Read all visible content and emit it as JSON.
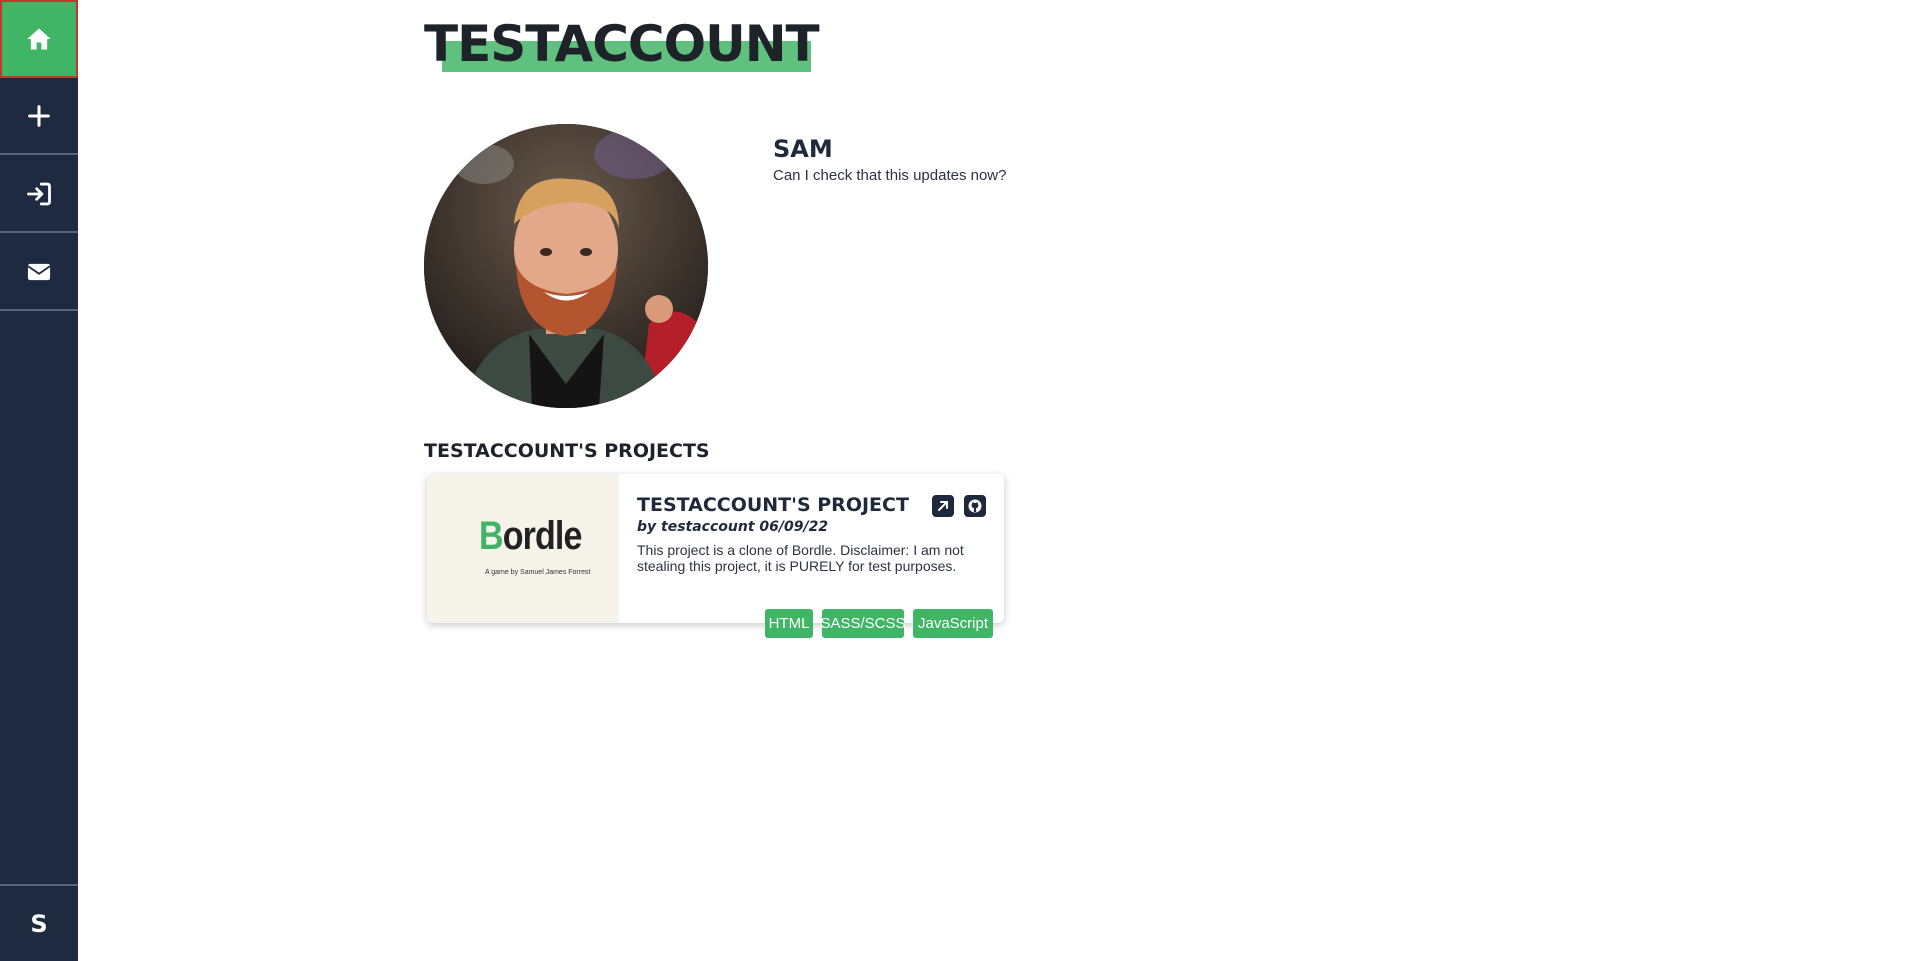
{
  "sidebar": {
    "items": [
      {
        "name": "home",
        "icon": "home-icon"
      },
      {
        "name": "add",
        "icon": "plus-icon"
      },
      {
        "name": "login",
        "icon": "sign-in-icon"
      },
      {
        "name": "contact",
        "icon": "envelope-icon"
      }
    ],
    "user_initial": "S"
  },
  "header": {
    "title": "TESTACCOUNT"
  },
  "profile": {
    "name": "SAM",
    "bio": "Can I check that this updates now?"
  },
  "projects": {
    "heading": "TESTACCOUNT'S PROJECTS",
    "items": [
      {
        "thumbnail": {
          "logo_accent": "B",
          "logo_rest": "ordle",
          "credit": "A game by Samuel James Forrest"
        },
        "title": "TESTACCOUNT'S PROJECT",
        "meta": "by testaccount 06/09/22",
        "description": "This project is a clone of Bordle. Disclaimer: I am not stealing this project, it is PURELY for test purposes.",
        "tags": [
          "HTML",
          "SASS/SCSS",
          "JavaScript"
        ]
      }
    ]
  },
  "colors": {
    "sidebar_bg": "#1e2a3f",
    "accent_green": "#3fb565",
    "text_dark": "#1e2a3b"
  }
}
